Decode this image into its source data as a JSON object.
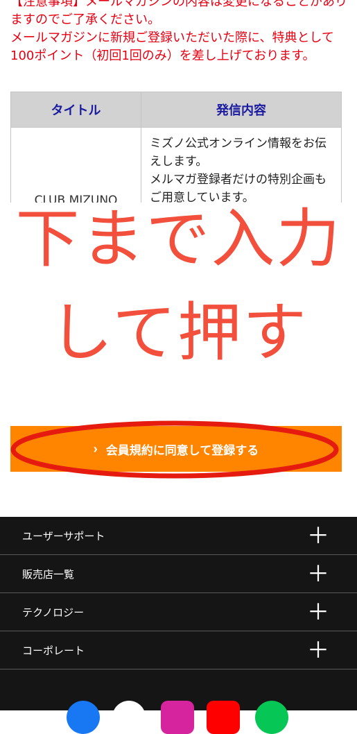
{
  "notice": {
    "text": "【注意事項】メールマガジンの内容は変更になることがありますのでご了承ください。\nメールマガジンに新規ご登録いただいた際に、特典として100ポイント（初回1回のみ）を差し上げております。"
  },
  "table": {
    "headers": [
      "タイトル",
      "発信内容"
    ],
    "rows": [
      {
        "title": "CLUB MIZUNO",
        "desc": "ミズノ公式オンライン情報をお伝えします。\nメルマガ登録者だけの特別企画もご用意しています。"
      }
    ]
  },
  "annotation": {
    "line1": "下まで入力",
    "line2": "して押す",
    "color": "#f2503c"
  },
  "register_button": {
    "label": "会員規約に同意して登録する",
    "color": "#ff8400"
  },
  "footer": {
    "items": [
      {
        "label": "ユーザーサポート"
      },
      {
        "label": "販売店一覧"
      },
      {
        "label": "テクノロジー"
      },
      {
        "label": "コーポレート"
      }
    ],
    "expand_icon": "plus-icon",
    "social_icons": [
      "facebook-icon",
      "x-icon",
      "instagram-icon",
      "youtube-icon",
      "line-icon"
    ]
  }
}
